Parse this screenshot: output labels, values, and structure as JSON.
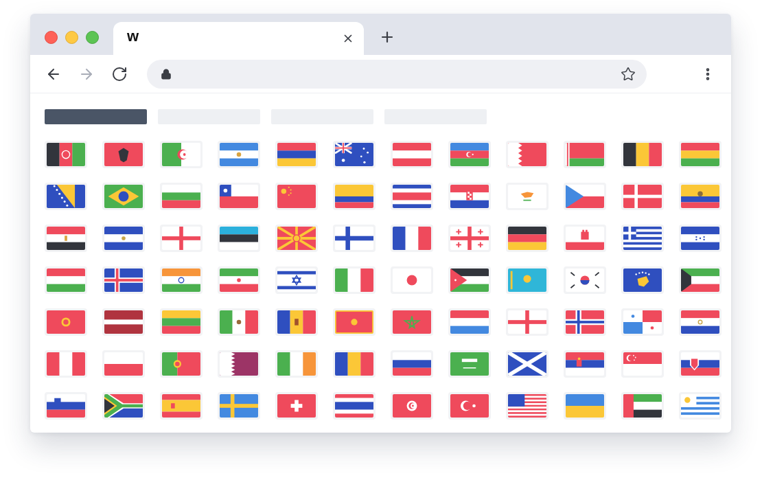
{
  "tab": {
    "logo": "w"
  },
  "nav": [
    {
      "kind": "back",
      "disabled": false
    },
    {
      "kind": "forward",
      "disabled": true
    },
    {
      "kind": "reload",
      "disabled": false
    }
  ],
  "filters": [
    {
      "selected": true
    },
    {
      "selected": false
    },
    {
      "selected": false
    },
    {
      "selected": false
    }
  ],
  "flags": [
    {
      "kind": "afghanistan"
    },
    {
      "kind": "albania"
    },
    {
      "kind": "algeria"
    },
    {
      "kind": "argentina"
    },
    {
      "kind": "armenia"
    },
    {
      "kind": "australia"
    },
    {
      "kind": "austria"
    },
    {
      "kind": "azerbaijan"
    },
    {
      "kind": "bahrain"
    },
    {
      "kind": "belarus"
    },
    {
      "kind": "belgium"
    },
    {
      "kind": "bolivia"
    },
    {
      "kind": "bosnia"
    },
    {
      "kind": "brazil"
    },
    {
      "kind": "bulgaria"
    },
    {
      "kind": "chile"
    },
    {
      "kind": "china"
    },
    {
      "kind": "colombia"
    },
    {
      "kind": "costarica"
    },
    {
      "kind": "croatia"
    },
    {
      "kind": "cyprus"
    },
    {
      "kind": "czech"
    },
    {
      "kind": "denmark"
    },
    {
      "kind": "ecuador"
    },
    {
      "kind": "egypt"
    },
    {
      "kind": "elsalvador"
    },
    {
      "kind": "england"
    },
    {
      "kind": "estonia"
    },
    {
      "kind": "macedonia"
    },
    {
      "kind": "finland"
    },
    {
      "kind": "france"
    },
    {
      "kind": "georgia"
    },
    {
      "kind": "germany"
    },
    {
      "kind": "gibraltar"
    },
    {
      "kind": "greece"
    },
    {
      "kind": "honduras"
    },
    {
      "kind": "hungary"
    },
    {
      "kind": "iceland"
    },
    {
      "kind": "india"
    },
    {
      "kind": "iran"
    },
    {
      "kind": "israel"
    },
    {
      "kind": "italy"
    },
    {
      "kind": "japan"
    },
    {
      "kind": "jordan"
    },
    {
      "kind": "kazakhstan"
    },
    {
      "kind": "korea"
    },
    {
      "kind": "kosovo"
    },
    {
      "kind": "kuwait"
    },
    {
      "kind": "kyrgyzstan"
    },
    {
      "kind": "latvia"
    },
    {
      "kind": "lithuania"
    },
    {
      "kind": "mexico"
    },
    {
      "kind": "moldova"
    },
    {
      "kind": "montenegro"
    },
    {
      "kind": "morocco"
    },
    {
      "kind": "netherlands"
    },
    {
      "kind": "nireland"
    },
    {
      "kind": "norway"
    },
    {
      "kind": "panama"
    },
    {
      "kind": "paraguay"
    },
    {
      "kind": "peru"
    },
    {
      "kind": "poland"
    },
    {
      "kind": "portugal"
    },
    {
      "kind": "qatar"
    },
    {
      "kind": "ireland"
    },
    {
      "kind": "romania"
    },
    {
      "kind": "russia"
    },
    {
      "kind": "saudi"
    },
    {
      "kind": "scotland"
    },
    {
      "kind": "serbia"
    },
    {
      "kind": "singapore"
    },
    {
      "kind": "slovakia"
    },
    {
      "kind": "slovenia"
    },
    {
      "kind": "southafrica"
    },
    {
      "kind": "spain"
    },
    {
      "kind": "sweden"
    },
    {
      "kind": "switzerland"
    },
    {
      "kind": "thailand"
    },
    {
      "kind": "tunisia"
    },
    {
      "kind": "turkey"
    },
    {
      "kind": "usa"
    },
    {
      "kind": "ukraine"
    },
    {
      "kind": "uae"
    },
    {
      "kind": "uruguay"
    }
  ]
}
